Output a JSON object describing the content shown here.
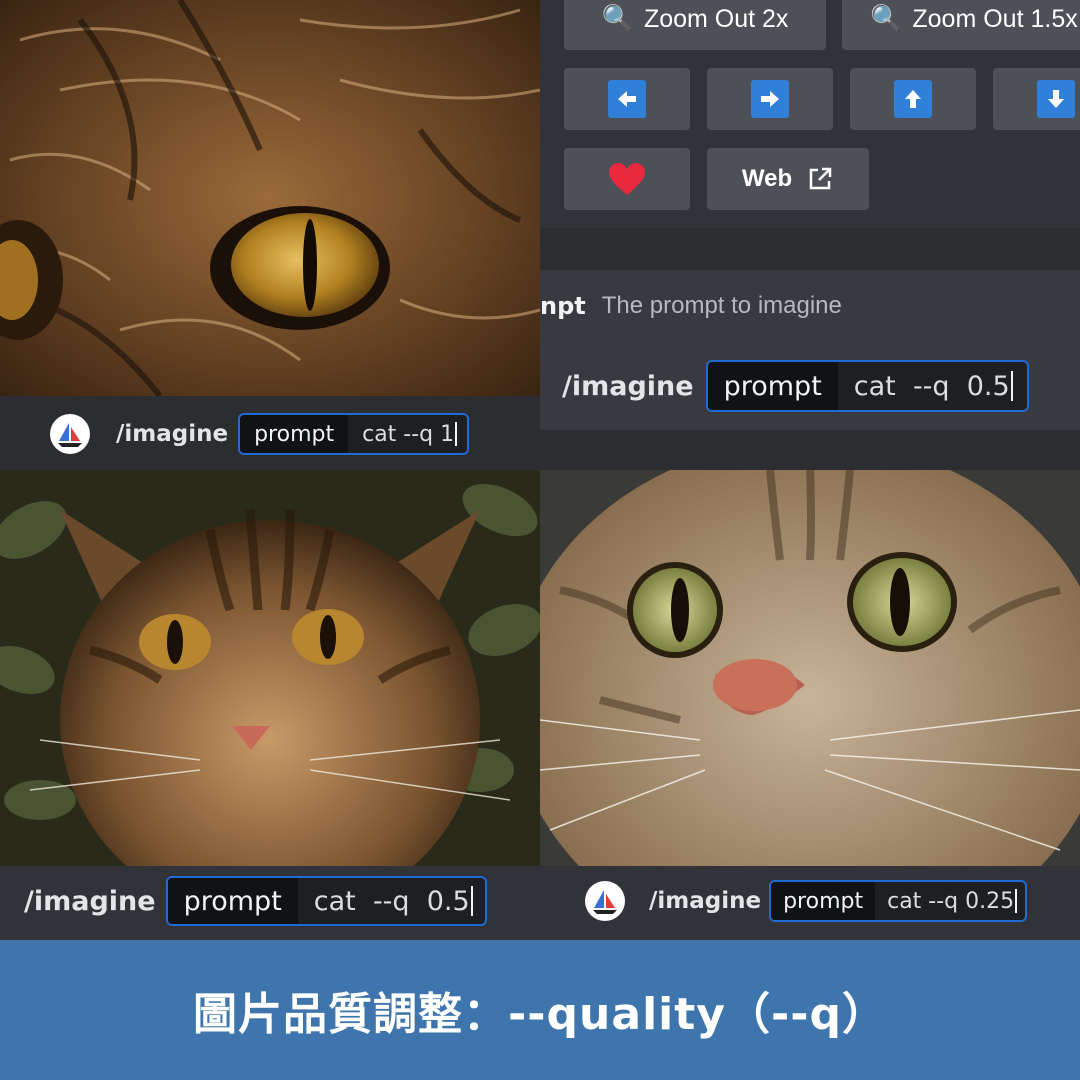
{
  "panels": {
    "top_left": {
      "command": "/imagine",
      "option": "prompt",
      "value": "cat --q 1",
      "avatar_icon": "midjourney-sailboat-icon"
    },
    "top_right": {
      "buttons_row1": [
        "Zoom Out 2x",
        "Zoom Out 1.5x"
      ],
      "arrow_buttons": [
        "arrow-left-icon",
        "arrow-right-icon",
        "arrow-up-icon",
        "arrow-down-icon"
      ],
      "favorite_icon": "heart-icon",
      "web_label": "Web",
      "web_icon": "external-link-icon",
      "hint_option": "npt",
      "hint_text": "The prompt to imagine",
      "command": "/imagine",
      "option": "prompt",
      "value": "cat  --q  0.5"
    },
    "bottom_left": {
      "command": "/imagine",
      "option": "prompt",
      "value": "cat  --q  0.5"
    },
    "bottom_right": {
      "command": "/imagine",
      "option": "prompt",
      "value": "cat --q 0.25",
      "avatar_icon": "midjourney-sailboat-icon"
    }
  },
  "banner": {
    "title": "圖片品質調整：--quality（--q）"
  },
  "colors": {
    "discord_bg": "#313338",
    "button_gray": "#4e5058",
    "input_border": "#1f6bd3",
    "arrow_blue": "#2f80d6",
    "banner_blue": "#3e75ac",
    "heart_red": "#e8283c"
  }
}
